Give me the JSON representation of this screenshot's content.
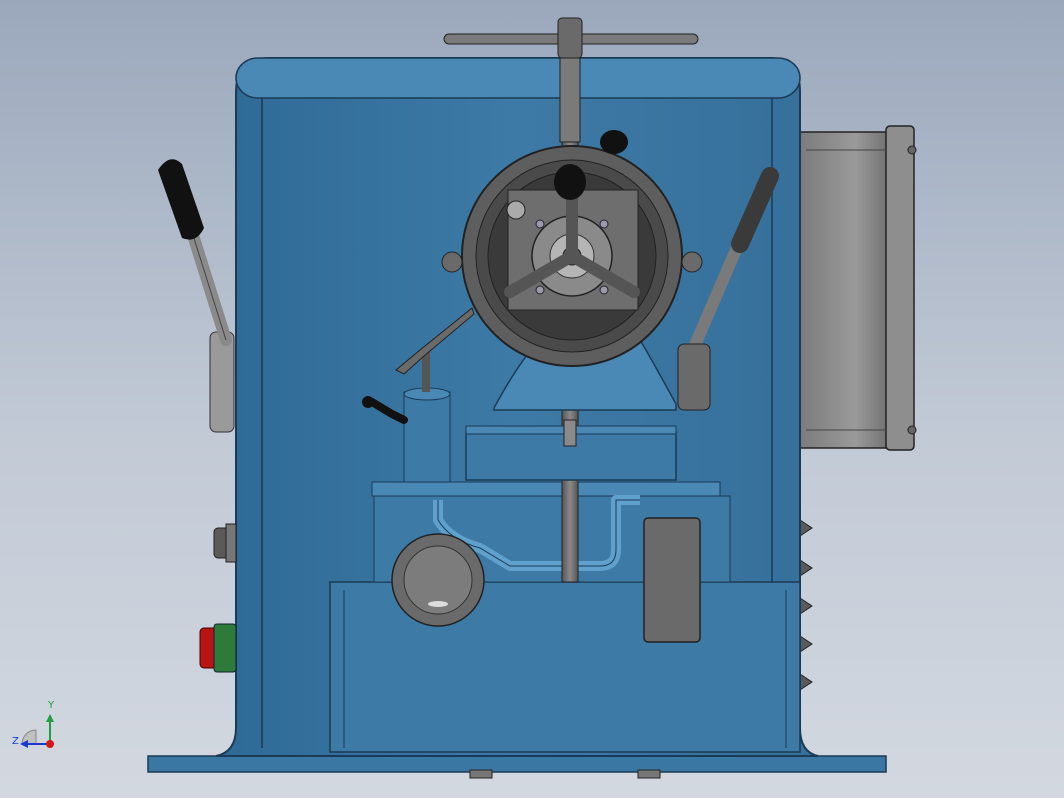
{
  "viewport": {
    "background_top": "#9ba8bc",
    "background_bottom": "#d3d8e0"
  },
  "model": {
    "body_color": "#3e7aa6",
    "body_highlight": "#5fa0cc",
    "metal_color": "#6e6e6e",
    "dark_metal": "#2a2a2a",
    "estop_color": "#b81414",
    "estop_ring": "#2d7a3a"
  },
  "triad": {
    "y_label": "Y",
    "z_label": "Z",
    "x_color": "#d01818",
    "y_color": "#1ea03c",
    "z_color": "#1a3ad0"
  }
}
